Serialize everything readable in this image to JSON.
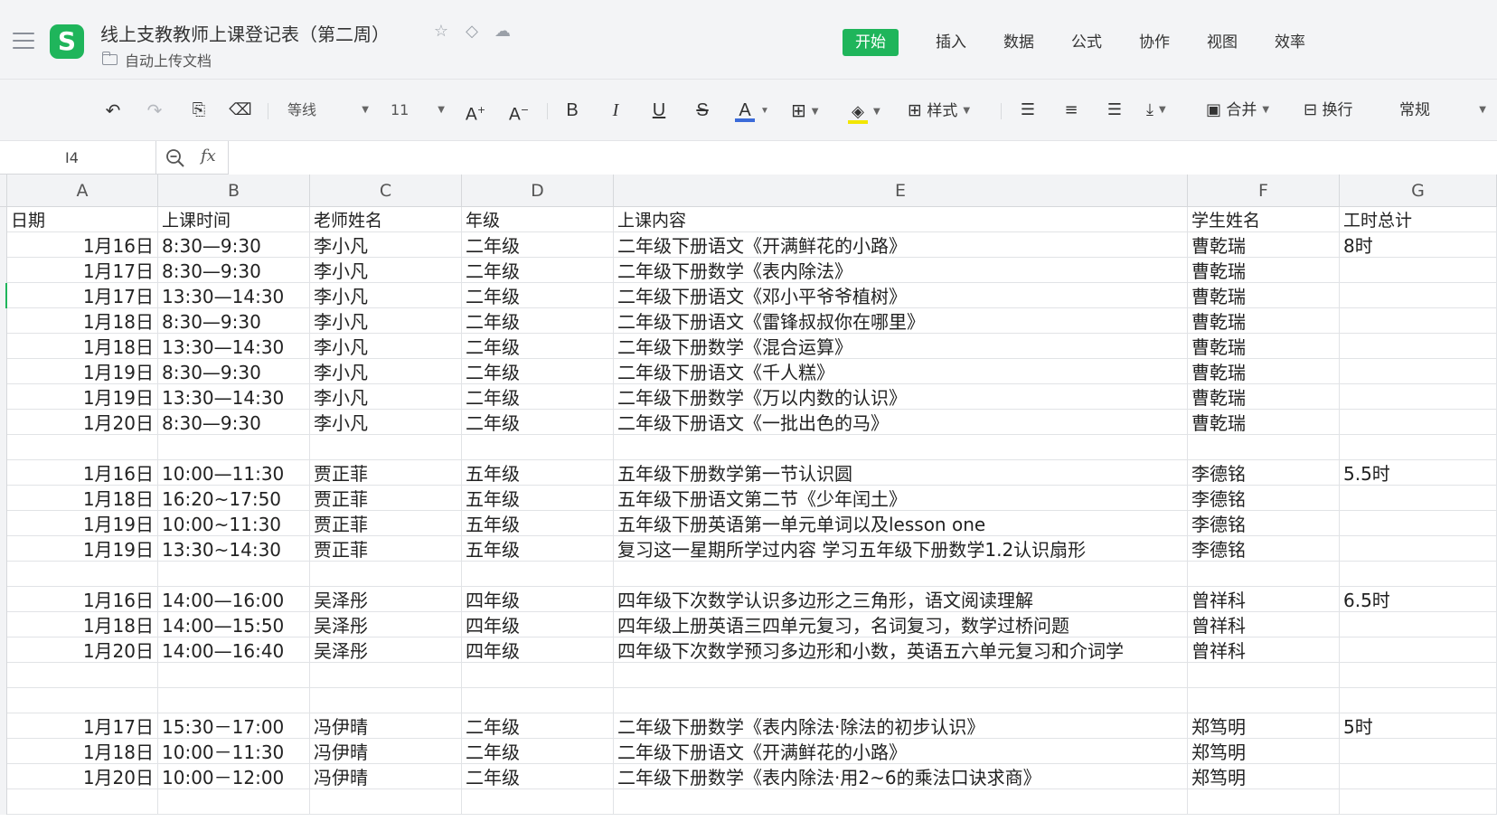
{
  "titlebar": {
    "title": "线上支教教师上课登记表（第二周）",
    "folder": "自动上传文档",
    "logo_letter": "S",
    "tabs": [
      "开始",
      "插入",
      "数据",
      "公式",
      "协作",
      "视图",
      "效率"
    ],
    "active_tab": "开始"
  },
  "toolbar": {
    "font_name": "等线",
    "font_size": "11",
    "style_label": "样式",
    "merge_label": "合并",
    "wrap_label": "换行",
    "number_format": "常规",
    "font_color": "#3b6bd9",
    "fill_color": "#f2e600"
  },
  "formula": {
    "cell_ref": "I4",
    "fx": "fx",
    "content": ""
  },
  "columns": [
    "A",
    "B",
    "C",
    "D",
    "E",
    "F",
    "G"
  ],
  "header_row": [
    "日期",
    "上课时间",
    "老师姓名",
    "年级",
    "上课内容",
    "学生姓名",
    "工时总计"
  ],
  "rows": [
    [
      "1月16日",
      "8:30—9:30",
      "李小凡",
      "二年级",
      "二年级下册语文《开满鲜花的小路》",
      "曹乾瑞",
      "8时"
    ],
    [
      "1月17日",
      "8:30—9:30",
      "李小凡",
      "二年级",
      "二年级下册数学《表内除法》",
      "曹乾瑞",
      ""
    ],
    [
      "1月17日",
      "13:30—14:30",
      "李小凡",
      "二年级",
      "二年级下册语文《邓小平爷爷植树》",
      "曹乾瑞",
      ""
    ],
    [
      "1月18日",
      "8:30—9:30",
      "李小凡",
      "二年级",
      "二年级下册语文《雷锋叔叔你在哪里》",
      "曹乾瑞",
      ""
    ],
    [
      "1月18日",
      "13:30—14:30",
      "李小凡",
      "二年级",
      "二年级下册数学《混合运算》",
      "曹乾瑞",
      ""
    ],
    [
      "1月19日",
      "8:30—9:30",
      "李小凡",
      "二年级",
      "二年级下册语文《千人糕》",
      "曹乾瑞",
      ""
    ],
    [
      "1月19日",
      "13:30—14:30",
      "李小凡",
      "二年级",
      "二年级下册数学《万以内数的认识》",
      "曹乾瑞",
      ""
    ],
    [
      "1月20日",
      "8:30—9:30",
      "李小凡",
      "二年级",
      "二年级下册语文《一批出色的马》",
      "曹乾瑞",
      ""
    ],
    [
      "",
      "",
      "",
      "",
      "",
      "",
      ""
    ],
    [
      "1月16日",
      "10:00—11:30",
      "贾正菲",
      "五年级",
      "五年级下册数学第一节认识圆",
      "李德铭",
      "5.5时"
    ],
    [
      "1月18日",
      "16:20~17:50",
      "贾正菲",
      "五年级",
      "五年级下册语文第二节《少年闰土》",
      "李德铭",
      ""
    ],
    [
      "1月19日",
      "10:00~11:30",
      "贾正菲",
      "五年级",
      "五年级下册英语第一单元单词以及lesson one",
      "李德铭",
      ""
    ],
    [
      "1月19日",
      "13:30~14:30",
      "贾正菲",
      "五年级",
      "复习这一星期所学过内容 学习五年级下册数学1.2认识扇形",
      "李德铭",
      ""
    ],
    [
      "",
      "",
      "",
      "",
      "",
      "",
      ""
    ],
    [
      "1月16日",
      "14:00—16:00",
      "吴泽彤",
      "四年级",
      "四年级下次数学认识多边形之三角形，语文阅读理解",
      "曾祥科",
      "6.5时"
    ],
    [
      "1月18日",
      "14:00—15:50",
      "吴泽彤",
      "四年级",
      "四年级上册英语三四单元复习，名词复习，数学过桥问题",
      "曾祥科",
      ""
    ],
    [
      "1月20日",
      "14:00—16:40",
      "吴泽彤",
      "四年级",
      "四年级下次数学预习多边形和小数，英语五六单元复习和介词学",
      "曾祥科",
      ""
    ],
    [
      "",
      "",
      "",
      "",
      "",
      "",
      ""
    ],
    [
      "",
      "",
      "",
      "",
      "",
      "",
      ""
    ],
    [
      "1月17日",
      "15:30－17:00",
      "冯伊晴",
      "二年级",
      "二年级下册数学《表内除法·除法的初步认识》",
      "郑笃明",
      "5时"
    ],
    [
      "1月18日",
      "10:00－11:30",
      "冯伊晴",
      "二年级",
      "二年级下册语文《开满鲜花的小路》",
      "郑笃明",
      ""
    ],
    [
      "1月20日",
      "10:00－12:00",
      "冯伊晴",
      "二年级",
      "二年级下册数学《表内除法·用2~6的乘法口诀求商》",
      "郑笃明",
      ""
    ],
    [
      "",
      "",
      "",
      "",
      "",
      "",
      ""
    ]
  ]
}
